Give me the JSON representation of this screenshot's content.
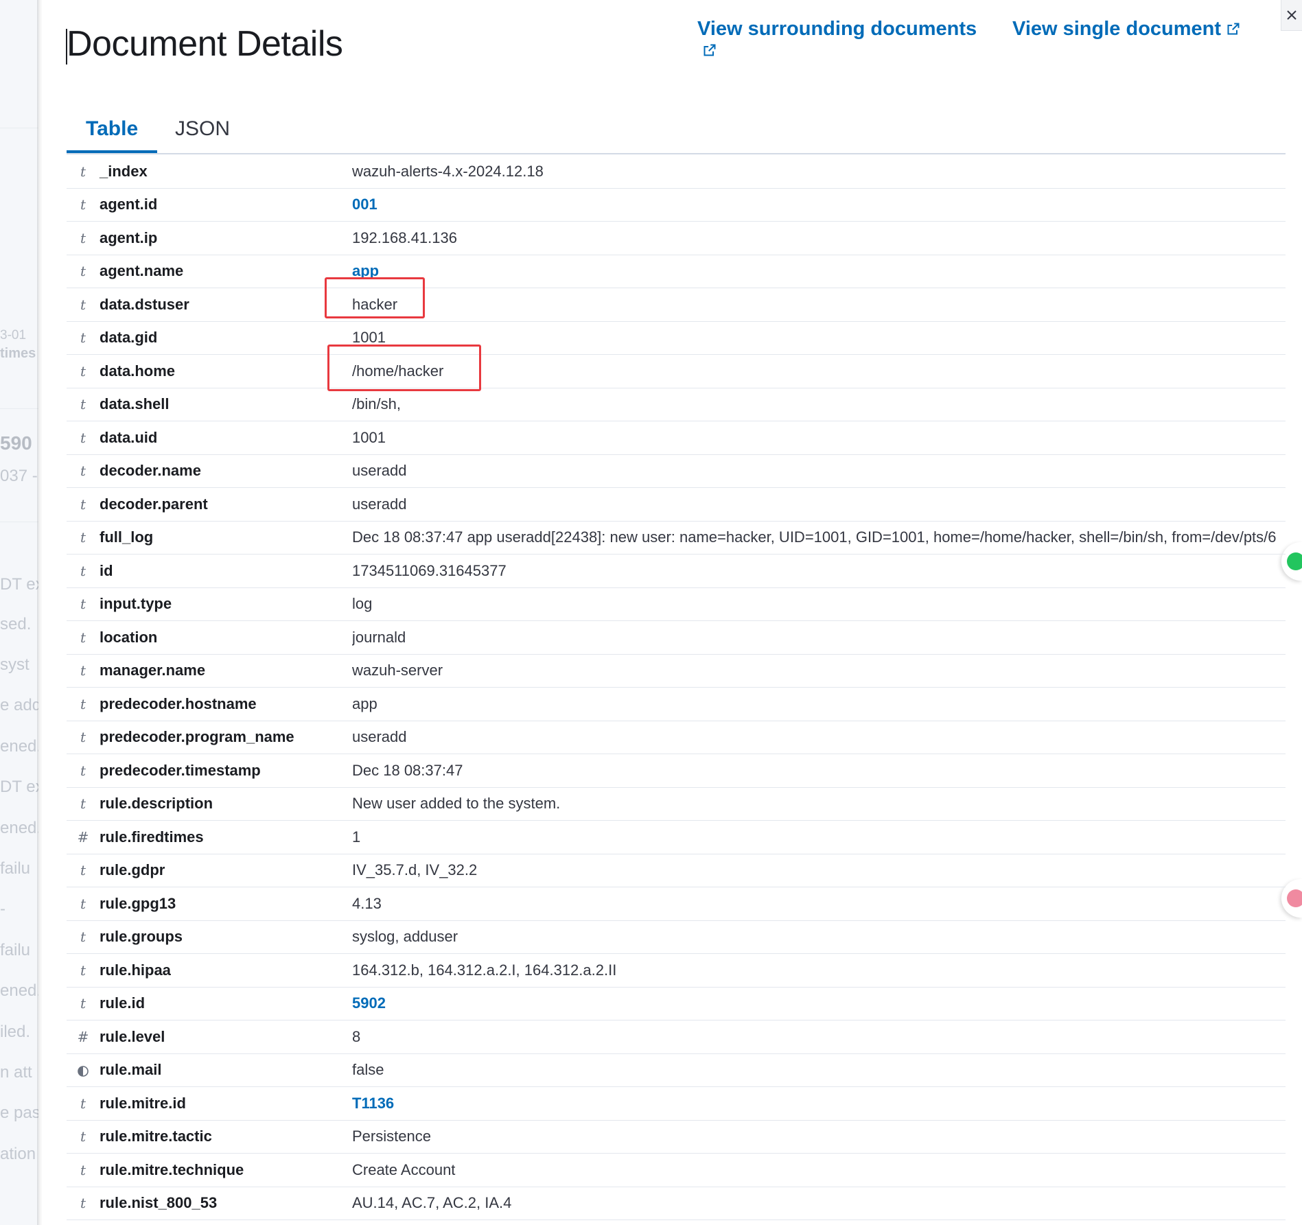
{
  "background_fragments": [
    "3-01",
    "times",
    "590",
    "037 -",
    "DT ex",
    "sed.",
    "syst",
    "e add",
    "ened.",
    "DT ex",
    "ened.",
    "failu",
    "-",
    "failu",
    "ened.",
    "iled.",
    "n att",
    "e pas",
    "ation"
  ],
  "flyout": {
    "title": "Document Details",
    "links": {
      "surrounding": "View surrounding documents",
      "single": "View single document"
    },
    "tabs": [
      {
        "label": "Table",
        "active": true
      },
      {
        "label": "JSON",
        "active": false
      }
    ],
    "rows": [
      {
        "type": "t",
        "field": "_index",
        "value": "wazuh-alerts-4.x-2024.12.18",
        "link": false
      },
      {
        "type": "t",
        "field": "agent.id",
        "value": "001",
        "link": true
      },
      {
        "type": "t",
        "field": "agent.ip",
        "value": "192.168.41.136",
        "link": false
      },
      {
        "type": "t",
        "field": "agent.name",
        "value": "app",
        "link": true
      },
      {
        "type": "t",
        "field": "data.dstuser",
        "value": "hacker",
        "link": false
      },
      {
        "type": "t",
        "field": "data.gid",
        "value": "1001",
        "link": false
      },
      {
        "type": "t",
        "field": "data.home",
        "value": "/home/hacker",
        "link": false
      },
      {
        "type": "t",
        "field": "data.shell",
        "value": "/bin/sh,",
        "link": false
      },
      {
        "type": "t",
        "field": "data.uid",
        "value": "1001",
        "link": false
      },
      {
        "type": "t",
        "field": "decoder.name",
        "value": "useradd",
        "link": false
      },
      {
        "type": "t",
        "field": "decoder.parent",
        "value": "useradd",
        "link": false
      },
      {
        "type": "t",
        "field": "full_log",
        "value": "Dec 18 08:37:47 app useradd[22438]: new user: name=hacker, UID=1001, GID=1001, home=/home/hacker, shell=/bin/sh, from=/dev/pts/6",
        "link": false
      },
      {
        "type": "t",
        "field": "id",
        "value": "1734511069.31645377",
        "link": false
      },
      {
        "type": "t",
        "field": "input.type",
        "value": "log",
        "link": false
      },
      {
        "type": "t",
        "field": "location",
        "value": "journald",
        "link": false
      },
      {
        "type": "t",
        "field": "manager.name",
        "value": "wazuh-server",
        "link": false
      },
      {
        "type": "t",
        "field": "predecoder.hostname",
        "value": "app",
        "link": false
      },
      {
        "type": "t",
        "field": "predecoder.program_name",
        "value": "useradd",
        "link": false
      },
      {
        "type": "t",
        "field": "predecoder.timestamp",
        "value": "Dec 18 08:37:47",
        "link": false
      },
      {
        "type": "t",
        "field": "rule.description",
        "value": "New user added to the system.",
        "link": false
      },
      {
        "type": "#",
        "field": "rule.firedtimes",
        "value": "1",
        "link": false
      },
      {
        "type": "t",
        "field": "rule.gdpr",
        "value": "IV_35.7.d, IV_32.2",
        "link": false
      },
      {
        "type": "t",
        "field": "rule.gpg13",
        "value": "4.13",
        "link": false
      },
      {
        "type": "t",
        "field": "rule.groups",
        "value": "syslog, adduser",
        "link": false
      },
      {
        "type": "t",
        "field": "rule.hipaa",
        "value": "164.312.b, 164.312.a.2.I, 164.312.a.2.II",
        "link": false
      },
      {
        "type": "t",
        "field": "rule.id",
        "value": "5902",
        "link": true
      },
      {
        "type": "#",
        "field": "rule.level",
        "value": "8",
        "link": false
      },
      {
        "type": "bool",
        "field": "rule.mail",
        "value": "false",
        "link": false
      },
      {
        "type": "t",
        "field": "rule.mitre.id",
        "value": "T1136",
        "link": true
      },
      {
        "type": "t",
        "field": "rule.mitre.tactic",
        "value": "Persistence",
        "link": false
      },
      {
        "type": "t",
        "field": "rule.mitre.technique",
        "value": "Create Account",
        "link": false
      },
      {
        "type": "t",
        "field": "rule.nist_800_53",
        "value": "AU.14, AC.7, AC.2, IA.4",
        "link": false
      }
    ]
  },
  "colors": {
    "accent": "#006bb8",
    "highlight": "#e8393f",
    "fab_green": "#22c55e",
    "fab_pink": "#f08aa0"
  }
}
